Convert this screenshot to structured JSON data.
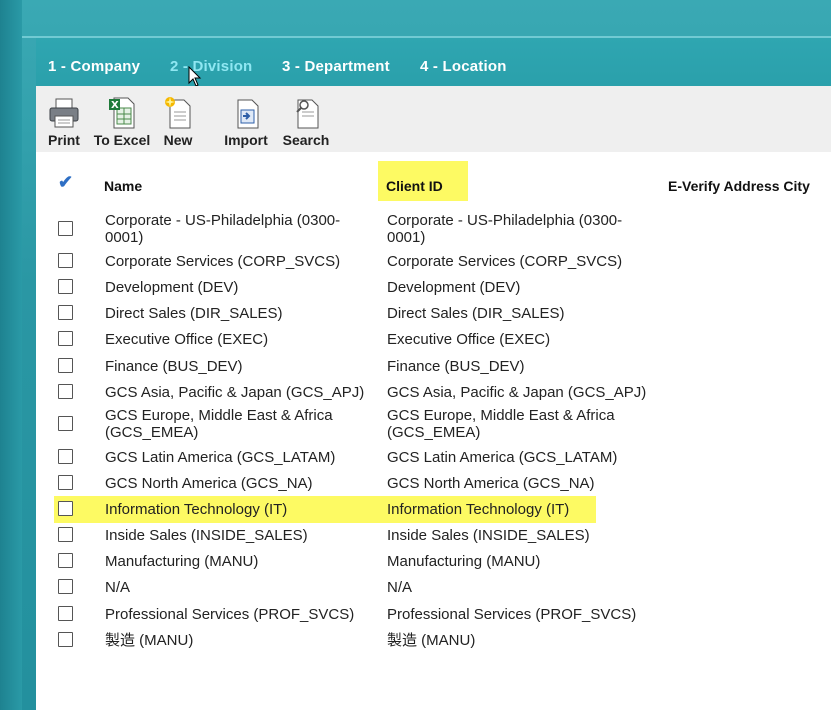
{
  "tabs": [
    {
      "label": "1 - Company"
    },
    {
      "label": "2 - Division"
    },
    {
      "label": "3 - Department"
    },
    {
      "label": "4 - Location"
    }
  ],
  "active_tab": "2 - Division",
  "toolbar": {
    "print": "Print",
    "to_excel": "To Excel",
    "new": "New",
    "import": "Import",
    "search": "Search"
  },
  "table": {
    "check_all": "✔",
    "headers": {
      "name": "Name",
      "client_id": "Client ID",
      "everify_city": "E-Verify Address City"
    },
    "rows": [
      {
        "name": "Corporate - US-Philadelphia (0300-0001)",
        "client_id": "Corporate - US-Philadelphia (0300-0001)"
      },
      {
        "name": "Corporate Services (CORP_SVCS)",
        "client_id": "Corporate Services (CORP_SVCS)"
      },
      {
        "name": "Development (DEV)",
        "client_id": "Development (DEV)"
      },
      {
        "name": "Direct Sales (DIR_SALES)",
        "client_id": "Direct Sales (DIR_SALES)"
      },
      {
        "name": "Executive Office (EXEC)",
        "client_id": "Executive Office (EXEC)"
      },
      {
        "name": "Finance (BUS_DEV)",
        "client_id": "Finance (BUS_DEV)"
      },
      {
        "name": "GCS Asia, Pacific & Japan (GCS_APJ)",
        "client_id": "GCS Asia, Pacific & Japan (GCS_APJ)"
      },
      {
        "name": "GCS Europe, Middle East & Africa (GCS_EMEA)",
        "client_id": "GCS Europe, Middle East & Africa (GCS_EMEA)"
      },
      {
        "name": "GCS Latin America (GCS_LATAM)",
        "client_id": "GCS Latin America (GCS_LATAM)"
      },
      {
        "name": "GCS North America (GCS_NA)",
        "client_id": "GCS North America (GCS_NA)"
      },
      {
        "name": "Information Technology (IT)",
        "client_id": "Information Technology (IT)"
      },
      {
        "name": "Inside Sales (INSIDE_SALES)",
        "client_id": "Inside Sales (INSIDE_SALES)"
      },
      {
        "name": "Manufacturing (MANU)",
        "client_id": "Manufacturing (MANU)"
      },
      {
        "name": "N/A",
        "client_id": "N/A"
      },
      {
        "name": "Professional Services (PROF_SVCS)",
        "client_id": "Professional Services (PROF_SVCS)"
      },
      {
        "name": "製造 (MANU)",
        "client_id": "製造 (MANU)"
      }
    ]
  },
  "colors": {
    "accent": "#2aa0ab",
    "highlight": "#fdfa63",
    "active_tab": "#8fe7f2"
  }
}
